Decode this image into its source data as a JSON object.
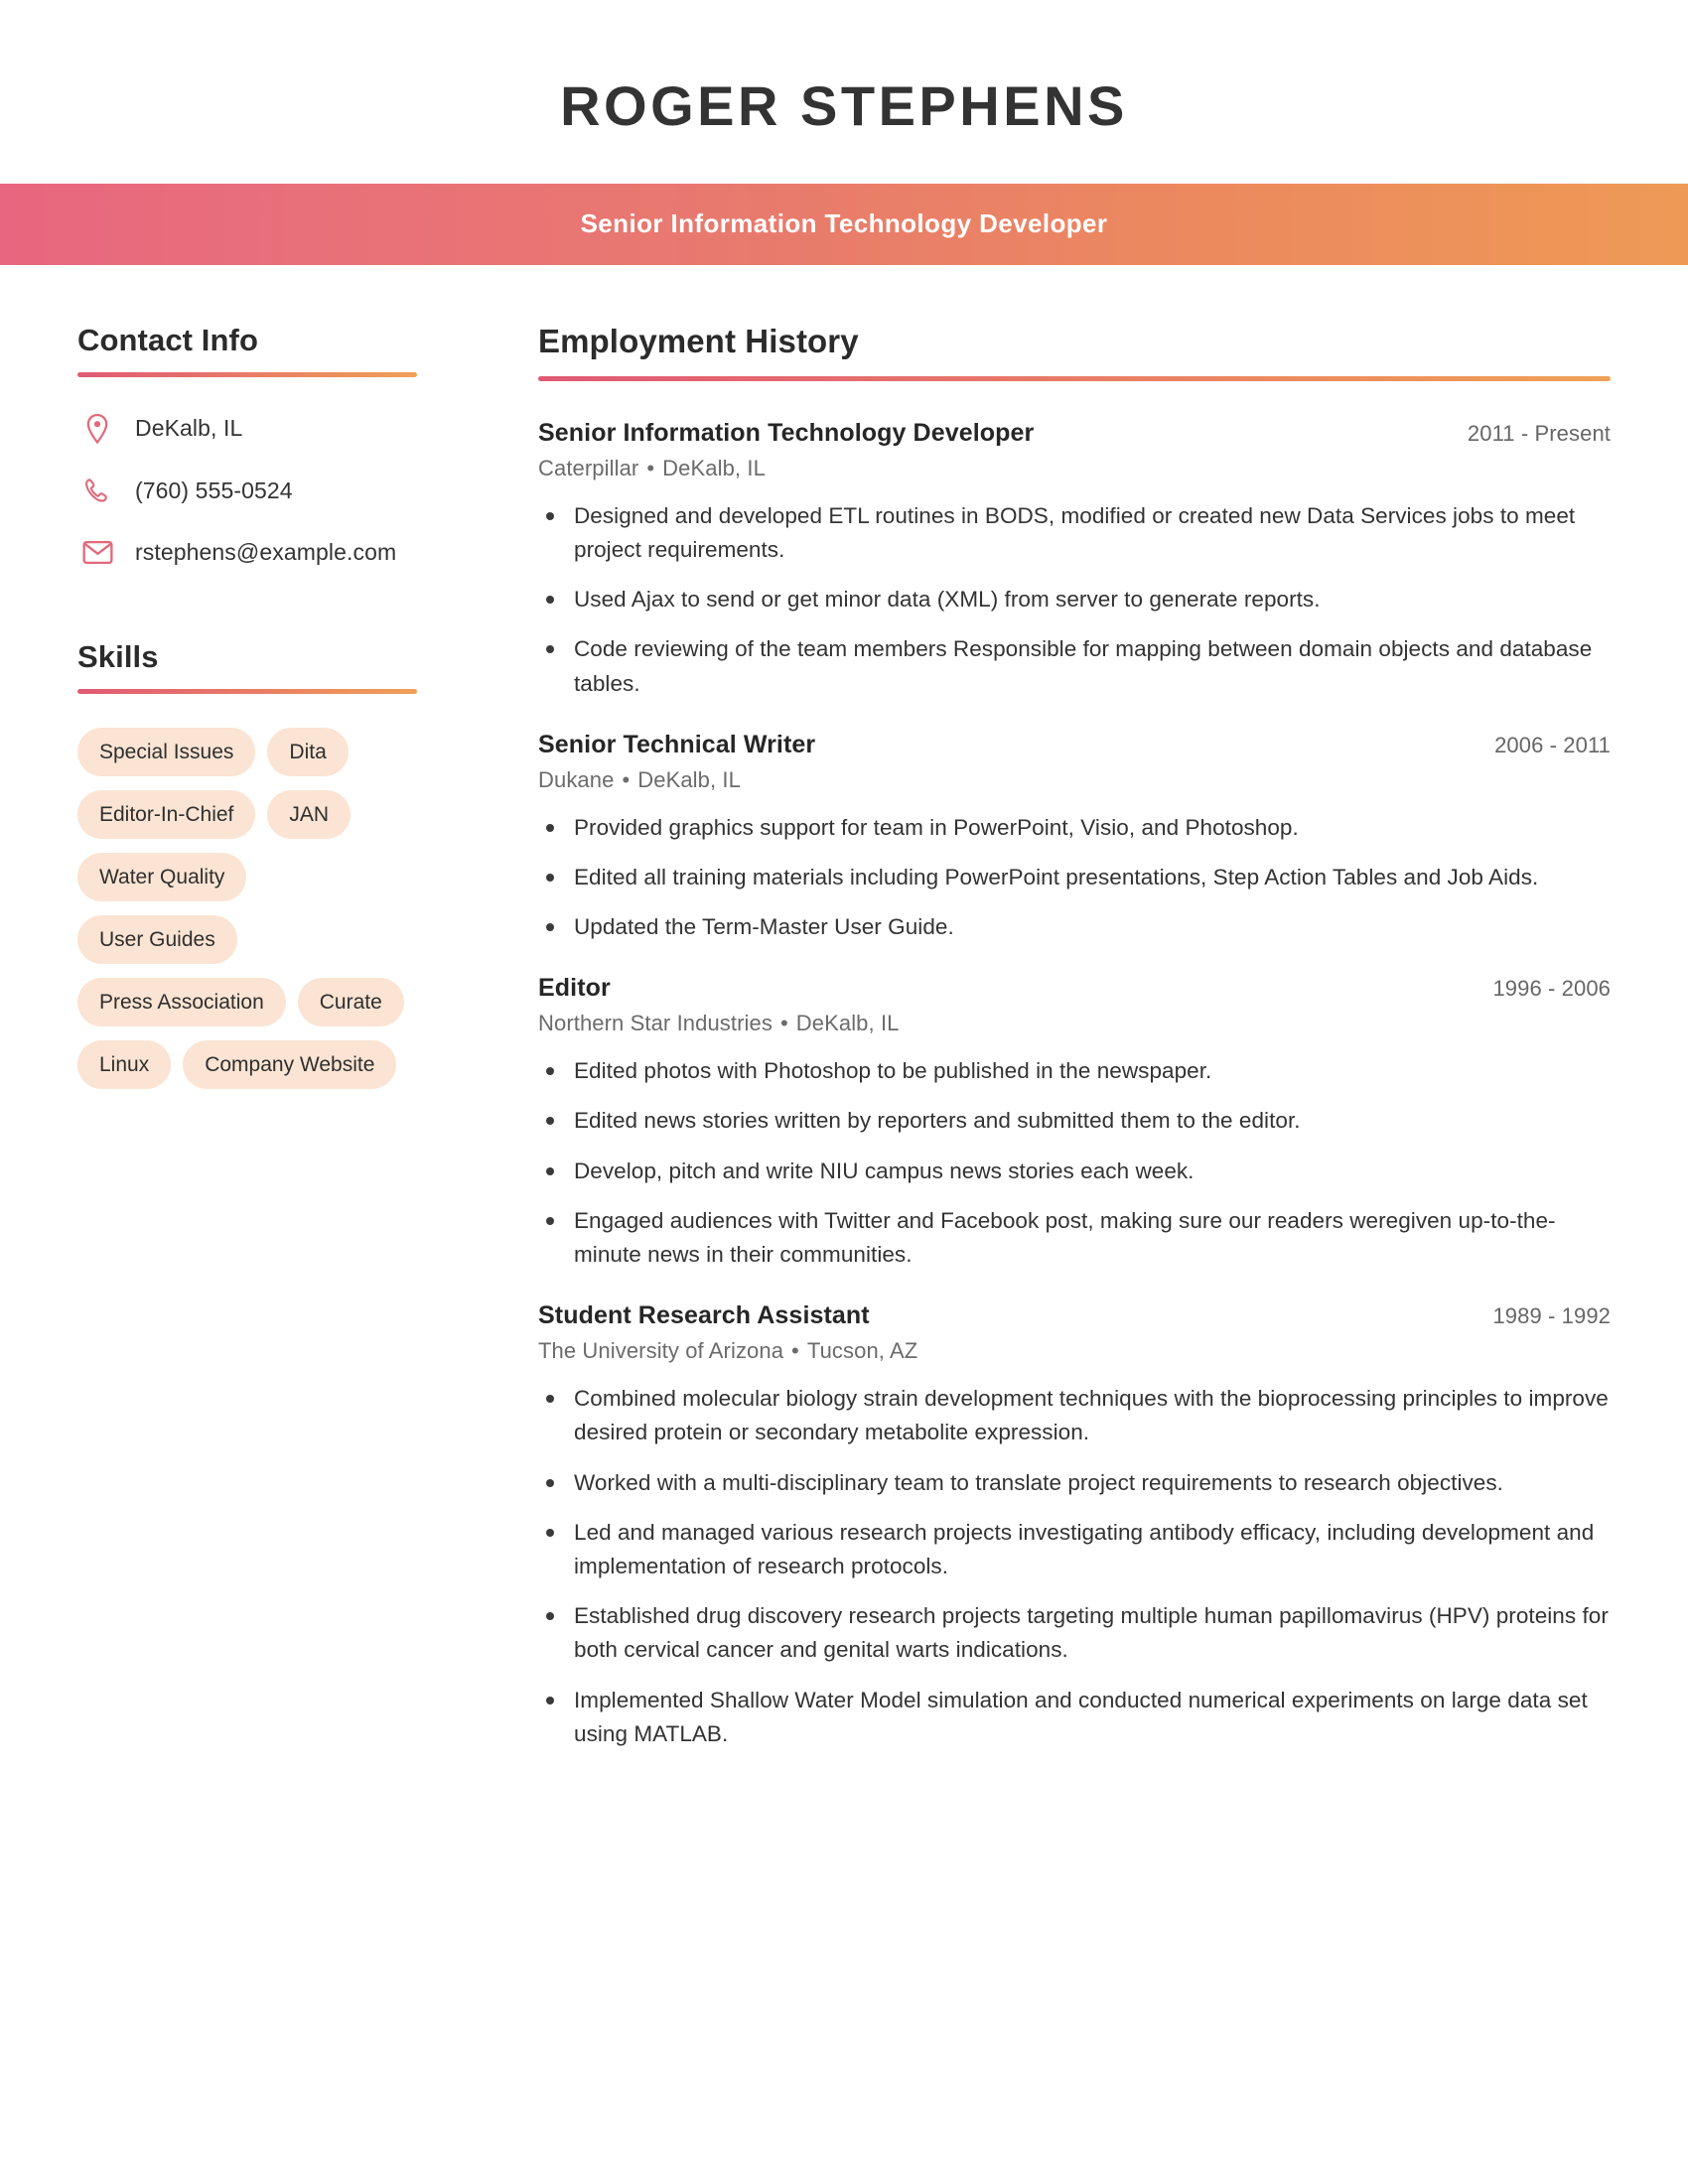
{
  "theme": {
    "gradient_start": "#e8667f",
    "gradient_end": "#ee9a56",
    "tag_background": "#fbe4d3",
    "icon_color": "#e0697a",
    "text_dark": "#2e2e2e",
    "text_muted": "#6b6b6b"
  },
  "header": {
    "full_name": "ROGER STEPHENS",
    "job_title": "Senior Information Technology Developer"
  },
  "sidebar": {
    "contact": {
      "heading": "Contact Info",
      "items": [
        {
          "icon": "location-pin-icon",
          "value": "DeKalb, IL"
        },
        {
          "icon": "phone-icon",
          "value": "(760) 555-0524"
        },
        {
          "icon": "envelope-icon",
          "value": "rstephens@example.com"
        }
      ]
    },
    "skills": {
      "heading": "Skills",
      "tags": [
        "Special Issues",
        "Dita",
        "Editor-In-Chief",
        "JAN",
        "Water Quality",
        "User Guides",
        "Press Association",
        "Curate",
        "Linux",
        "Company Website"
      ]
    }
  },
  "main": {
    "heading": "Employment History",
    "separator": "•",
    "jobs": [
      {
        "role": "Senior Information Technology Developer",
        "company": "Caterpillar",
        "location": "DeKalb, IL",
        "dates": "2011 - Present",
        "bullets": [
          "Designed and developed ETL routines in BODS, modified or created new Data Services jobs to meet project requirements.",
          "Used Ajax to send or get minor data (XML) from server to generate reports.",
          "Code reviewing of the team members Responsible for mapping between domain objects and database tables."
        ]
      },
      {
        "role": "Senior Technical Writer",
        "company": "Dukane",
        "location": "DeKalb, IL",
        "dates": "2006 - 2011",
        "bullets": [
          "Provided graphics support for team in PowerPoint, Visio, and Photoshop.",
          "Edited all training materials including PowerPoint presentations, Step Action Tables and Job Aids.",
          "Updated the Term-Master User Guide."
        ]
      },
      {
        "role": "Editor",
        "company": "Northern Star Industries",
        "location": "DeKalb, IL",
        "dates": "1996 - 2006",
        "bullets": [
          "Edited photos with Photoshop to be published in the newspaper.",
          "Edited news stories written by reporters and submitted them to the editor.",
          "Develop, pitch and write NIU campus news stories each week.",
          "Engaged audiences with Twitter and Facebook post, making sure our readers weregiven up-to-the-minute news in their communities."
        ]
      },
      {
        "role": "Student Research Assistant",
        "company": "The University of Arizona",
        "location": "Tucson, AZ",
        "dates": "1989 - 1992",
        "bullets": [
          "Combined molecular biology strain development techniques with the bioprocessing principles to improve desired protein or secondary metabolite expression.",
          "Worked with a multi-disciplinary team to translate project requirements to research objectives.",
          "Led and managed various research projects investigating antibody efficacy, including development and implementation of research protocols.",
          "Established drug discovery research projects targeting multiple human papillomavirus (HPV) proteins for both cervical cancer and genital warts indications.",
          "Implemented Shallow Water Model simulation and conducted numerical experiments on large data set using MATLAB."
        ]
      }
    ]
  }
}
